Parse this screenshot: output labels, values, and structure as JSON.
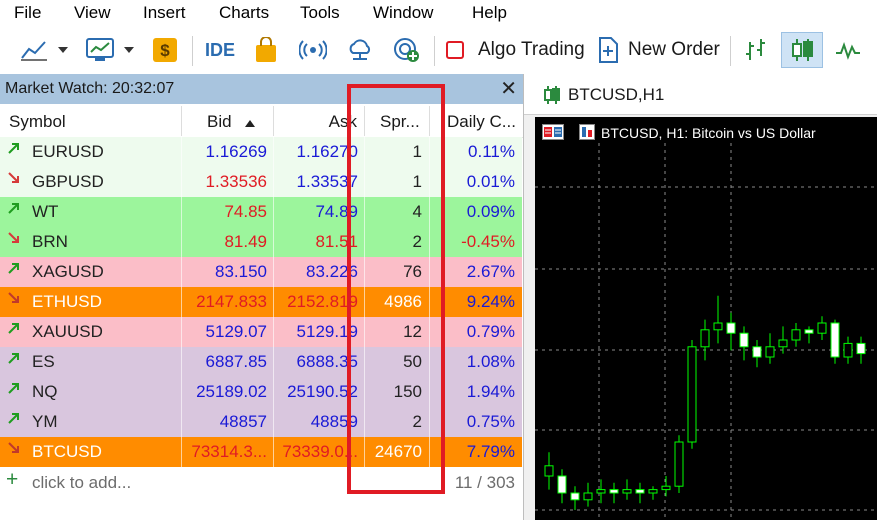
{
  "menu": [
    "File",
    "View",
    "Insert",
    "Charts",
    "Tools",
    "Window",
    "Help"
  ],
  "toolbar": {
    "ide_label": "IDE",
    "algo_label": "Algo Trading",
    "neworder_label": "New Order",
    "icons": [
      "line-chart-icon",
      "dashboard-icon",
      "dollar-coin-icon",
      "ide-icon",
      "shopping-bag-icon",
      "signal-broadcast-icon",
      "cloud-icon",
      "vps-globe-icon",
      "stop-icon",
      "new-order-icon",
      "bar-chart-icon",
      "candlestick-icon",
      "line-wave-icon"
    ]
  },
  "market_watch": {
    "title": "Market Watch: 20:32:07",
    "close": "✕",
    "columns": {
      "symbol": "Symbol",
      "bid": "Bid",
      "ask": "Ask",
      "spread": "Spr...",
      "daily": "Daily C..."
    },
    "rows": [
      {
        "dir": "up",
        "symbol": "EURUSD",
        "bid": "1.16269",
        "ask": "1.16270",
        "spread": "1",
        "daily": "0.11%",
        "bg": "#eefbee",
        "bid_color": "#1a1ad6",
        "ask_color": "#1a1ad6",
        "daily_color": "#1a1ad6"
      },
      {
        "dir": "down",
        "symbol": "GBPUSD",
        "bid": "1.33536",
        "ask": "1.33537",
        "spread": "1",
        "daily": "0.01%",
        "bg": "#eefbee",
        "bid_color": "#e01b24",
        "ask_color": "#1a1ad6",
        "daily_color": "#1a1ad6"
      },
      {
        "dir": "up",
        "symbol": "WT",
        "bid": "74.85",
        "ask": "74.89",
        "spread": "4",
        "daily": "0.09%",
        "bg": "#9cf59c",
        "bid_color": "#e01b24",
        "ask_color": "#1a1ad6",
        "daily_color": "#1a1ad6"
      },
      {
        "dir": "down",
        "symbol": "BRN",
        "bid": "81.49",
        "ask": "81.51",
        "spread": "2",
        "daily": "-0.45%",
        "bg": "#9cf59c",
        "bid_color": "#e01b24",
        "ask_color": "#e01b24",
        "daily_color": "#e01b24"
      },
      {
        "dir": "up",
        "symbol": "XAGUSD",
        "bid": "83.150",
        "ask": "83.226",
        "spread": "76",
        "daily": "2.67%",
        "bg": "#fbbec8",
        "bid_color": "#1a1ad6",
        "ask_color": "#1a1ad6",
        "daily_color": "#1a1ad6"
      },
      {
        "dir": "down",
        "symbol": "ETHUSD",
        "bid": "2147.833",
        "ask": "2152.819",
        "spread": "4986",
        "daily": "9.24%",
        "bg": "#ff8c00",
        "bid_color": "#e01b24",
        "ask_color": "#e01b24",
        "daily_color": "#1a1ad6",
        "white": true
      },
      {
        "dir": "up",
        "symbol": "XAUUSD",
        "bid": "5129.07",
        "ask": "5129.19",
        "spread": "12",
        "daily": "0.79%",
        "bg": "#fbbec8",
        "bid_color": "#1a1ad6",
        "ask_color": "#1a1ad6",
        "daily_color": "#1a1ad6"
      },
      {
        "dir": "up",
        "symbol": "ES",
        "bid": "6887.85",
        "ask": "6888.35",
        "spread": "50",
        "daily": "1.08%",
        "bg": "#d9c6de",
        "bid_color": "#1a1ad6",
        "ask_color": "#1a1ad6",
        "daily_color": "#1a1ad6"
      },
      {
        "dir": "up",
        "symbol": "NQ",
        "bid": "25189.02",
        "ask": "25190.52",
        "spread": "150",
        "daily": "1.94%",
        "bg": "#d9c6de",
        "bid_color": "#1a1ad6",
        "ask_color": "#1a1ad6",
        "daily_color": "#1a1ad6"
      },
      {
        "dir": "up",
        "symbol": "YM",
        "bid": "48857",
        "ask": "48859",
        "spread": "2",
        "daily": "0.75%",
        "bg": "#d9c6de",
        "bid_color": "#1a1ad6",
        "ask_color": "#1a1ad6",
        "daily_color": "#1a1ad6"
      },
      {
        "dir": "down",
        "symbol": "BTCUSD",
        "bid": "73314.3...",
        "ask": "73339.0...",
        "spread": "24670",
        "daily": "7.79%",
        "bg": "#ff8c00",
        "bid_color": "#e01b24",
        "ask_color": "#e01b24",
        "daily_color": "#1a1ad6",
        "white": true
      }
    ],
    "add_label": "click to add...",
    "count": "11 / 303"
  },
  "chart": {
    "tab_title": "BTCUSD,H1",
    "label": "BTCUSD, H1:  Bitcoin vs US Dollar",
    "candles": [
      {
        "o": 0.1,
        "c": 0.13,
        "h": 0.17,
        "l": 0.06
      },
      {
        "o": 0.1,
        "c": 0.05,
        "h": 0.12,
        "l": 0.02
      },
      {
        "o": 0.05,
        "c": 0.03,
        "h": 0.07,
        "l": 0.0
      },
      {
        "o": 0.03,
        "c": 0.05,
        "h": 0.08,
        "l": 0.01
      },
      {
        "o": 0.05,
        "c": 0.06,
        "h": 0.09,
        "l": 0.02
      },
      {
        "o": 0.06,
        "c": 0.05,
        "h": 0.08,
        "l": 0.02
      },
      {
        "o": 0.05,
        "c": 0.06,
        "h": 0.09,
        "l": 0.03
      },
      {
        "o": 0.06,
        "c": 0.05,
        "h": 0.08,
        "l": 0.02
      },
      {
        "o": 0.05,
        "c": 0.06,
        "h": 0.07,
        "l": 0.03
      },
      {
        "o": 0.06,
        "c": 0.07,
        "h": 0.1,
        "l": 0.04
      },
      {
        "o": 0.07,
        "c": 0.2,
        "h": 0.22,
        "l": 0.05
      },
      {
        "o": 0.2,
        "c": 0.48,
        "h": 0.5,
        "l": 0.18
      },
      {
        "o": 0.48,
        "c": 0.53,
        "h": 0.56,
        "l": 0.44
      },
      {
        "o": 0.53,
        "c": 0.55,
        "h": 0.63,
        "l": 0.49
      },
      {
        "o": 0.55,
        "c": 0.52,
        "h": 0.58,
        "l": 0.47
      },
      {
        "o": 0.52,
        "c": 0.48,
        "h": 0.54,
        "l": 0.44
      },
      {
        "o": 0.48,
        "c": 0.45,
        "h": 0.5,
        "l": 0.42
      },
      {
        "o": 0.45,
        "c": 0.48,
        "h": 0.52,
        "l": 0.43
      },
      {
        "o": 0.48,
        "c": 0.5,
        "h": 0.54,
        "l": 0.46
      },
      {
        "o": 0.5,
        "c": 0.53,
        "h": 0.55,
        "l": 0.48
      },
      {
        "o": 0.53,
        "c": 0.52,
        "h": 0.54,
        "l": 0.49
      },
      {
        "o": 0.52,
        "c": 0.55,
        "h": 0.57,
        "l": 0.5
      },
      {
        "o": 0.55,
        "c": 0.45,
        "h": 0.56,
        "l": 0.43
      },
      {
        "o": 0.45,
        "c": 0.49,
        "h": 0.51,
        "l": 0.43
      },
      {
        "o": 0.49,
        "c": 0.46,
        "h": 0.51,
        "l": 0.43
      }
    ]
  }
}
